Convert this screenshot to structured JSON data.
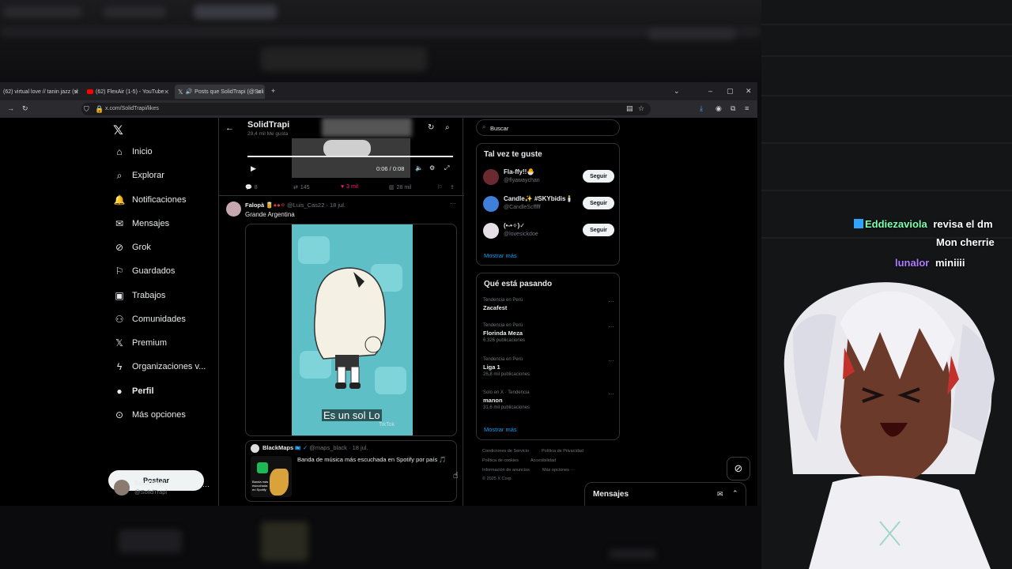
{
  "browser": {
    "tabs": [
      {
        "label": "(62) virtual love // tanin jazz (sl"
      },
      {
        "label": "(62) FlexAir (1-5) - YouTube"
      },
      {
        "label": "Posts que SolidTrapi (@Soli"
      }
    ],
    "url": "x.com/SolidTrapi/likes"
  },
  "sidebar": {
    "items": [
      {
        "label": "Inicio",
        "icon": "home-icon"
      },
      {
        "label": "Explorar",
        "icon": "search-icon"
      },
      {
        "label": "Notificaciones",
        "icon": "bell-icon"
      },
      {
        "label": "Mensajes",
        "icon": "mail-icon"
      },
      {
        "label": "Grok",
        "icon": "grok-icon"
      },
      {
        "label": "Guardados",
        "icon": "bookmark-icon"
      },
      {
        "label": "Trabajos",
        "icon": "briefcase-icon"
      },
      {
        "label": "Comunidades",
        "icon": "people-icon"
      },
      {
        "label": "Premium",
        "icon": "x-logo-icon"
      },
      {
        "label": "Organizaciones v...",
        "icon": "lightning-icon"
      },
      {
        "label": "Perfil",
        "icon": "person-icon"
      },
      {
        "label": "Más opciones",
        "icon": "more-circle-icon"
      }
    ],
    "post_button": "Postear",
    "account": {
      "name": "SolidTrapi",
      "handle": "@SolidTrapi"
    }
  },
  "feed": {
    "header": {
      "name": "SolidTrapi",
      "subtitle": "29,4 mil Me gusta"
    },
    "video1": {
      "time": "0:06 / 0:08"
    },
    "actions1": {
      "replies": "8",
      "reposts": "145",
      "likes": "3 mil",
      "views": "28 mil"
    },
    "post": {
      "author": "Falopà",
      "handle": "@Luis_Cas22",
      "date": "18 jul.",
      "text": "Grande Argentina",
      "caption": "Es un sol Lo",
      "watermark": "TikTok"
    },
    "quote": {
      "author": "BlackMaps",
      "handle": "@maps_black",
      "date": "18 jul.",
      "text": "Banda de música más escuchada en Spotify por país 🎵",
      "thumb_text": "Banda más escuchada en Spotify"
    }
  },
  "right": {
    "search_placeholder": "Buscar",
    "who_to_follow": {
      "title": "Tal vez te guste",
      "users": [
        {
          "name": "Fla-ffy!!🐣",
          "handle": "@flyawaychan"
        },
        {
          "name": "Candle✨ #SKYbidis🕯️",
          "handle": "@CandleScfffff"
        },
        {
          "name": "(•-•✧)✓",
          "handle": "@lovesickdoe"
        }
      ],
      "follow_label": "Seguir",
      "more": "Mostrar más"
    },
    "trends": {
      "title": "Qué está pasando",
      "items": [
        {
          "context": "Tendencia en Perú",
          "title": "Zacafest",
          "count": ""
        },
        {
          "context": "Tendencia en Perú",
          "title": "Florinda Meza",
          "count": "6.326 publicaciones"
        },
        {
          "context": "Tendencia en Perú",
          "title": "Liga 1",
          "count": "26,8 mil publicaciones"
        },
        {
          "context": "Solo en X · Tendencia",
          "title": "manon",
          "count": "31,6 mil publicaciones"
        }
      ],
      "more": "Mostrar más"
    },
    "footer": {
      "l1": "Condiciones de Servicio",
      "l2": "Política de Privacidad",
      "l3": "Política de cookies",
      "l4": "Accesibilidad",
      "l5": "Información de anuncios",
      "l6": "Más opciones ···",
      "l7": "© 2025 X Corp."
    }
  },
  "messages_drawer": {
    "label": "Mensajes"
  },
  "stream_chat": [
    {
      "user": "Eddiezaviola",
      "message": "revisa el dm",
      "color": "#7dffb0"
    },
    {
      "user": "",
      "message": "Mon cherrie",
      "color": "#ffffff"
    },
    {
      "user": "lunalor",
      "message": "miniiii",
      "color": "#b07cff"
    }
  ]
}
